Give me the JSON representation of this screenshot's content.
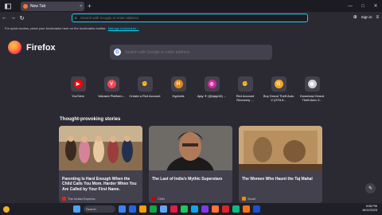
{
  "tab": {
    "title": "New Tab",
    "close": "×",
    "new": "+"
  },
  "window_controls": [
    "—",
    "□",
    "✕"
  ],
  "nav": {
    "back": "←",
    "forward": "→",
    "reload": "↻"
  },
  "urlbar": {
    "placeholder": "Search with Google or enter address"
  },
  "toolbar_right": {
    "sign_in": "Sign in",
    "pocket": "⊕",
    "menu": "≡"
  },
  "bookmarks_bar": {
    "text": "For quick access, place your bookmarks here on the bookmarks toolbar.",
    "link": "Manage bookmarks…"
  },
  "brand": {
    "name": "Firefox"
  },
  "search": {
    "placeholder": "Search with Google or enter address",
    "g": "G"
  },
  "shortcuts": [
    {
      "label": "YouTube",
      "glyph": "▶",
      "color": "#ff0000"
    },
    {
      "label": "Valorant Platform...",
      "glyph": "V",
      "color": "#fa4454"
    },
    {
      "label": "Create a Riot Account",
      "glyph": "✊",
      "color": "#42414d"
    },
    {
      "label": "Hypixels",
      "glyph": "H",
      "color": "#e08a1e"
    },
    {
      "label": "Ajay ✈ (@ajay18) ...",
      "glyph": "◎",
      "color": "#d6249f"
    },
    {
      "label": "Riot Account Recovery ...",
      "glyph": "✊",
      "color": "#42414d"
    },
    {
      "label": "Buy Grand Theft Auto V (GTA 5...",
      "glyph": "G",
      "color": "#f5a623"
    },
    {
      "label": "Download Grand Theft Auto V...",
      "glyph": "◉",
      "color": "#cfcfd8"
    }
  ],
  "stories": {
    "heading": "Thought-provoking stories",
    "cards": [
      {
        "title": "Parenting Is Hard Enough When the Child Calls You Mom. Harder When You Are Called by Your First Name.",
        "source": "The Indian Express",
        "src_color": "#e1251b"
      },
      {
        "title": "The Last of India's Mythic Superstars",
        "source": "CNN",
        "src_color": "#cc0000"
      },
      {
        "title": "The Women Who Haunt the Taj Mahal",
        "source": "Scroll",
        "src_color": "#f08c00"
      }
    ]
  },
  "edit": "✎",
  "taskbar": {
    "search": "Search",
    "apps": [
      "#3b82f6",
      "#2563eb",
      "#f59e0b",
      "#16a34a",
      "#60a5fa",
      "#e11d48",
      "#22c55e",
      "#0ea5e9",
      "#7c3aed",
      "#ff7139",
      "#dc2626",
      "#10b981",
      "#f97316",
      "#1d4ed8"
    ],
    "time": "5:08 PM",
    "date": "16/12/2023"
  }
}
